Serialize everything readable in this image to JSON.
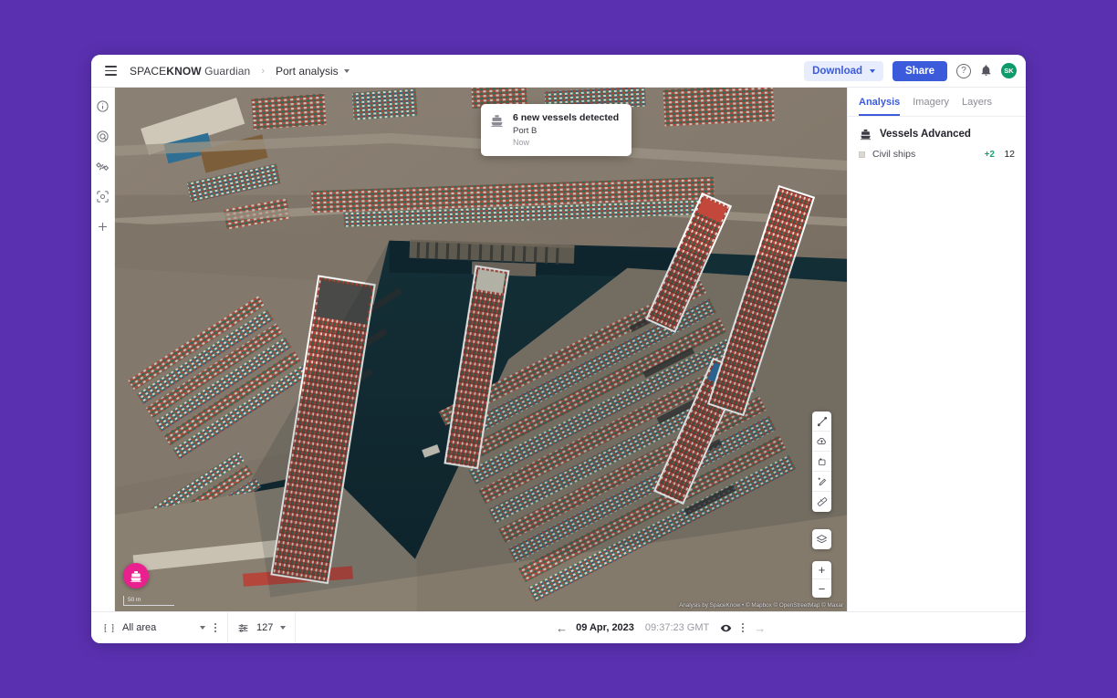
{
  "theme": {
    "background": "#5a30b0",
    "accent": "#3b5bdb",
    "positive": "#17a673",
    "badge": "#e8218f",
    "avatar": "#0d9b6c"
  },
  "header": {
    "menu_icon": "hamburger-icon",
    "brand_prefix": "SPACE",
    "brand_bold": "KNOW",
    "brand_suffix": "Guardian",
    "breadcrumb_separator": "›",
    "breadcrumb_current": "Port analysis",
    "download_label": "Download",
    "share_label": "Share",
    "help_glyph": "?",
    "avatar_initials": "SK"
  },
  "left_rail": {
    "items": [
      {
        "name": "info-icon",
        "title": "Info"
      },
      {
        "name": "target-icon",
        "title": "Target"
      },
      {
        "name": "satellite-icon",
        "title": "Satellite"
      },
      {
        "name": "scan-icon",
        "title": "Scan area"
      },
      {
        "name": "plus-icon",
        "title": "Add"
      }
    ]
  },
  "toast": {
    "icon": "ship-icon",
    "title": "6 new vessels detected",
    "subtitle": "Port B",
    "time": "Now"
  },
  "map_tools": {
    "tools": [
      {
        "name": "measure-line-icon",
        "title": "Measure"
      },
      {
        "name": "cloud-upload-icon",
        "title": "Upload"
      },
      {
        "name": "crop-add-icon",
        "title": "Add area"
      },
      {
        "name": "pencil-add-icon",
        "title": "Draw"
      },
      {
        "name": "ruler-icon",
        "title": "Ruler"
      }
    ],
    "layers_icon": "layers-stack-icon",
    "zoom_in": "+",
    "zoom_out": "−"
  },
  "map_overlay": {
    "vessel_badge_icon": "ship-icon",
    "scale_label": "50 m",
    "attribution": "Analysis by SpaceKnow • © Mapbox © OpenStreetMap © Maxar"
  },
  "right_panel": {
    "tabs": [
      {
        "label": "Analysis",
        "active": true
      },
      {
        "label": "Imagery",
        "active": false
      },
      {
        "label": "Layers",
        "active": false
      }
    ],
    "section_icon": "ship-icon",
    "section_title": "Vessels Advanced",
    "rows": [
      {
        "swatch": "#ded9d0",
        "label": "Civil ships",
        "delta": "+2",
        "count": "12"
      }
    ]
  },
  "bottom_bar": {
    "area_icon": "area-frame-icon",
    "area_label": "All area",
    "filter_icon": "sliders-icon",
    "filter_value": "127",
    "prev_arrow": "←",
    "next_arrow": "→",
    "date": "09 Apr, 2023",
    "time": "09:37:23 GMT",
    "eye_icon": "eye-icon"
  }
}
